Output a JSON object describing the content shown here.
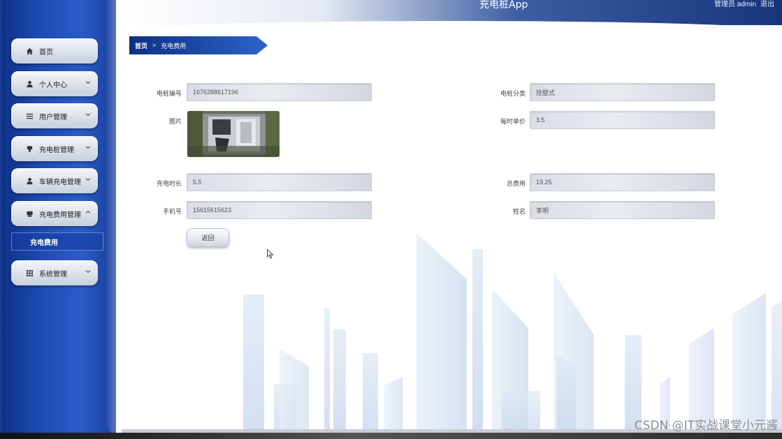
{
  "app": {
    "title": "充电桩App"
  },
  "header": {
    "user_label": "管理员 admin",
    "logout_label": "退出"
  },
  "sidebar": {
    "items": [
      {
        "label": "首页",
        "icon": "home-icon"
      },
      {
        "label": "个人中心",
        "icon": "user-icon"
      },
      {
        "label": "用户管理",
        "icon": "list-icon"
      },
      {
        "label": "充电桩管理",
        "icon": "charger-icon"
      },
      {
        "label": "车辆充电管理",
        "icon": "person-icon"
      },
      {
        "label": "充电费用管理",
        "icon": "fee-icon",
        "expanded": true
      },
      {
        "label": "系统管理",
        "icon": "grid-icon"
      }
    ],
    "sub_item": {
      "label": "充电费用"
    }
  },
  "breadcrumb": {
    "home": "首页",
    "separator": ">",
    "current": "充电费用"
  },
  "form": {
    "pile_no": {
      "label": "电桩编号",
      "value": "1676288617196"
    },
    "pile_type": {
      "label": "电桩分类",
      "value": "挂壁式"
    },
    "picture": {
      "label": "图片"
    },
    "hourly_price": {
      "label": "每时单价",
      "value": "3.5"
    },
    "duration": {
      "label": "充电时长",
      "value": "5.5"
    },
    "total_fee": {
      "label": "总费用",
      "value": "19.25"
    },
    "phone": {
      "label": "手机号",
      "value": "15615615623"
    },
    "name": {
      "label": "姓名",
      "value": "李明"
    },
    "back_label": "返回"
  },
  "watermark": "CSDN @IT实战课堂小元酱",
  "colors": {
    "sidebar": "#1d4cb4",
    "accent": "#0e2f83",
    "field": "#e3e7ed"
  }
}
